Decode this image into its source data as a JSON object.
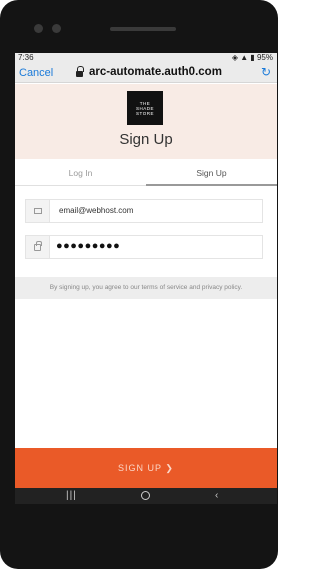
{
  "status": {
    "time": "7:36",
    "battery": "95%"
  },
  "browser": {
    "cancel_label": "Cancel",
    "url": "arc-automate.auth0.com",
    "reload_icon": "reload-icon"
  },
  "brand": {
    "logo_text": "THE SHADE STORE"
  },
  "page": {
    "title": "Sign Up"
  },
  "tabs": [
    {
      "label": "Log In",
      "active": false
    },
    {
      "label": "Sign Up",
      "active": true
    }
  ],
  "form": {
    "email": {
      "value": "email@webhost.com",
      "icon": "envelope-icon"
    },
    "password": {
      "masked_value": "●●●●●●●●●",
      "icon": "lock-icon"
    },
    "terms_text": "By signing up, you agree to our terms of service and privacy policy.",
    "submit_label": "SIGN UP ❯"
  },
  "colors": {
    "accent": "#ea5a28",
    "header_bg": "#f8ebe5",
    "link": "#1a7ad9"
  }
}
